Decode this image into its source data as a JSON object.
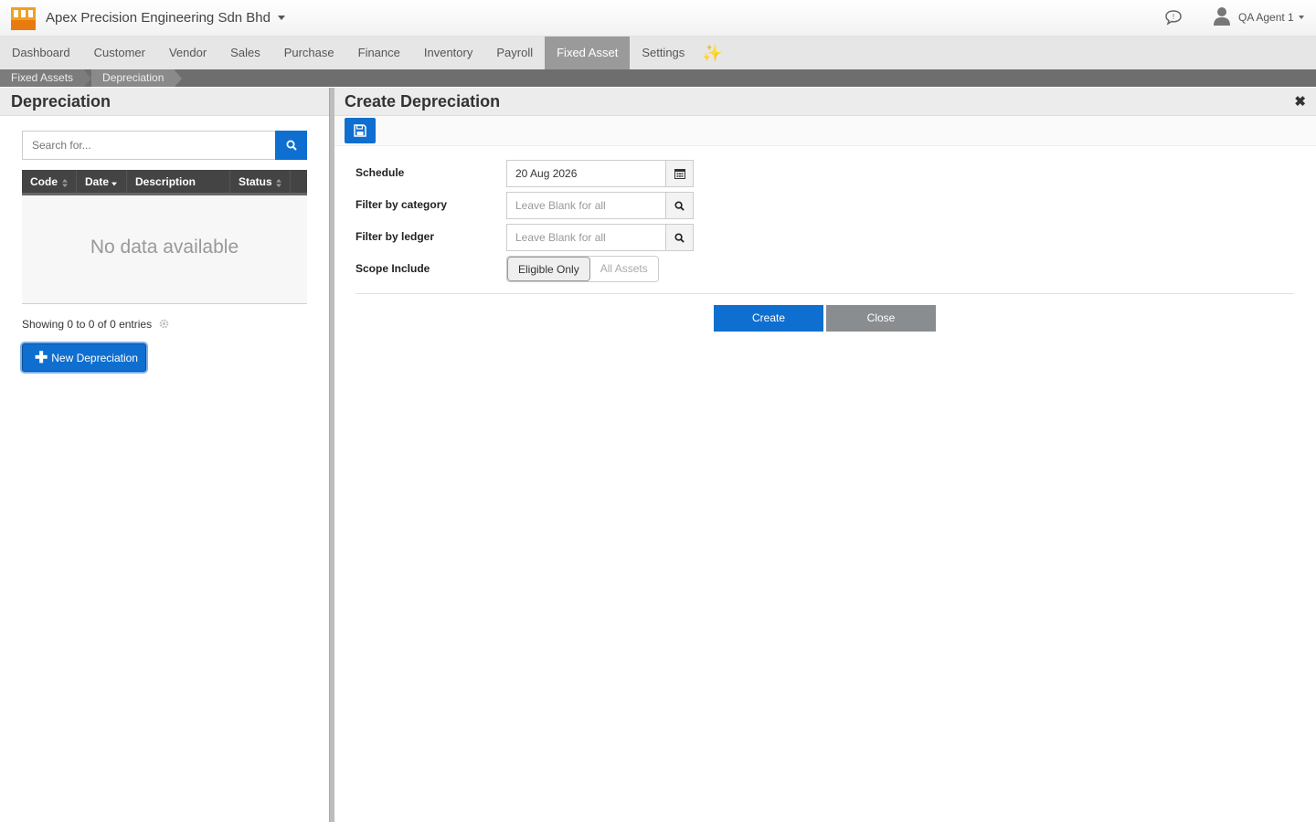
{
  "header": {
    "company": "Apex Precision Engineering Sdn Bhd",
    "user": "QA Agent 1"
  },
  "nav": {
    "items": [
      "Dashboard",
      "Customer",
      "Vendor",
      "Sales",
      "Purchase",
      "Finance",
      "Inventory",
      "Payroll",
      "Fixed Asset",
      "Settings"
    ],
    "active": "Fixed Asset",
    "sparkle": "✨"
  },
  "breadcrumb": [
    "Fixed Assets",
    "Depreciation"
  ],
  "left": {
    "title": "Depreciation",
    "search_placeholder": "Search for...",
    "columns": [
      "Code",
      "Date",
      "Description",
      "Status"
    ],
    "empty_text": "No data available",
    "showing": "Showing 0 to 0 of 0 entries",
    "new_button": "New Depreciation"
  },
  "form": {
    "title": "Create Depreciation",
    "schedule_label": "Schedule",
    "schedule_value": "20 Aug 2026",
    "category_label": "Filter by category",
    "category_placeholder": "Leave Blank for all",
    "ledger_label": "Filter by ledger",
    "ledger_placeholder": "Leave Blank for all",
    "scope_label": "Scope Include",
    "scope_options": [
      "Eligible Only",
      "All Assets"
    ],
    "scope_selected": "Eligible Only",
    "create_button": "Create",
    "close_button": "Close"
  },
  "colors": {
    "primary": "#0f6fd0",
    "nav_active": "#9a9a9a",
    "close_button": "#8a8d90"
  }
}
